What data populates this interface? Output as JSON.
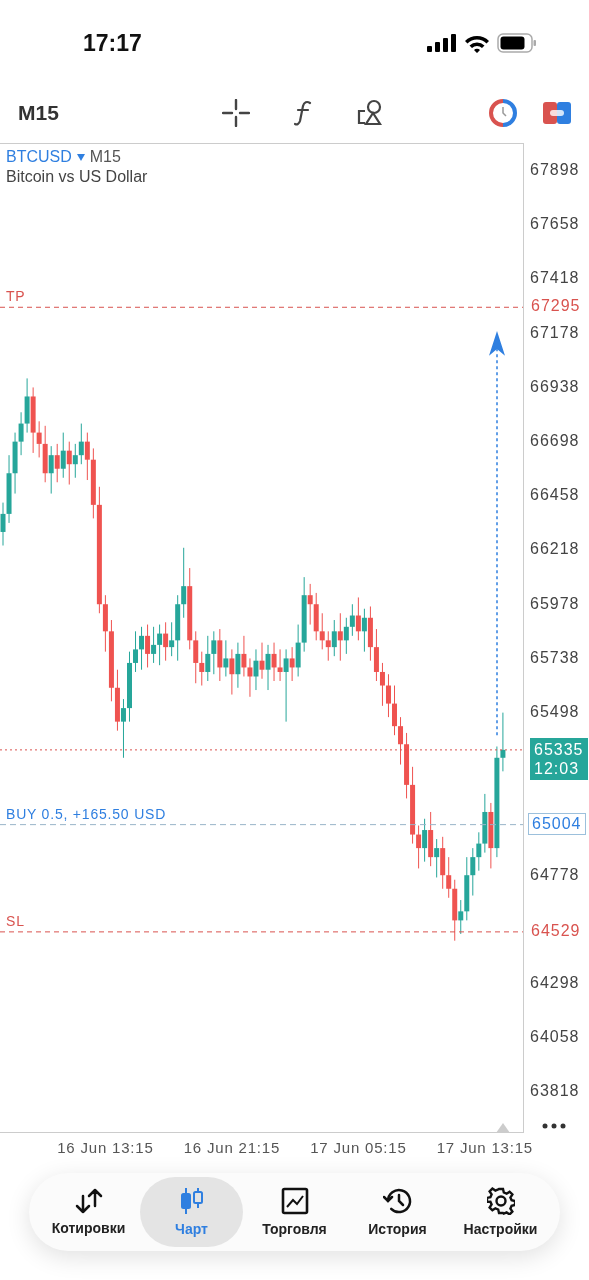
{
  "status_bar": {
    "time": "17:17"
  },
  "toolbar": {
    "timeframe": "M15"
  },
  "chart": {
    "symbol": "BTCUSD",
    "symbol_timeframe": "M15",
    "description": "Bitcoin vs US Dollar",
    "levels": [
      {
        "kind": "tp",
        "label": "TP",
        "price": "67295"
      },
      {
        "kind": "current",
        "price": "65335",
        "timer": "12:03"
      },
      {
        "kind": "buy",
        "label": "BUY 0.5, +165.50 USD",
        "price": "65004"
      },
      {
        "kind": "sl",
        "label": "SL",
        "price": "64529"
      }
    ],
    "chart_data": {
      "type": "candlestick",
      "categories": [
        null,
        null,
        null,
        null,
        null,
        null,
        null,
        null,
        null,
        null,
        null,
        null,
        null,
        null,
        null,
        null,
        null,
        "16 Jun 13:15",
        null,
        null,
        null,
        null,
        null,
        null,
        null,
        null,
        null,
        null,
        null,
        null,
        null,
        null,
        null,
        null,
        null,
        null,
        null,
        null,
        "16 Jun 21:15",
        null,
        null,
        null,
        null,
        null,
        null,
        null,
        null,
        null,
        null,
        null,
        null,
        null,
        null,
        null,
        null,
        null,
        null,
        null,
        null,
        "17 Jun 05:15",
        null,
        null,
        null,
        null,
        null,
        null,
        null,
        null,
        null,
        null,
        null,
        null,
        null,
        null,
        null,
        null,
        null,
        null,
        null,
        null,
        "17 Jun 13:15",
        null,
        null,
        null,
        null,
        null,
        null
      ],
      "ohlc": [
        [
          66300,
          66430,
          66240,
          66380
        ],
        [
          66380,
          66640,
          66340,
          66560
        ],
        [
          66560,
          66740,
          66470,
          66700
        ],
        [
          66700,
          66830,
          66640,
          66780
        ],
        [
          66780,
          66980,
          66740,
          66900
        ],
        [
          66900,
          66940,
          66650,
          66740
        ],
        [
          66740,
          66790,
          66630,
          66690
        ],
        [
          66690,
          66770,
          66520,
          66560
        ],
        [
          66560,
          66680,
          66470,
          66640
        ],
        [
          66640,
          66690,
          66520,
          66580
        ],
        [
          66580,
          66740,
          66540,
          66660
        ],
        [
          66660,
          66700,
          66510,
          66600
        ],
        [
          66600,
          66690,
          66540,
          66640
        ],
        [
          66640,
          66780,
          66600,
          66700
        ],
        [
          66700,
          66740,
          66530,
          66620
        ],
        [
          66620,
          66670,
          66360,
          66420
        ],
        [
          66420,
          66500,
          65940,
          65980
        ],
        [
          65980,
          66020,
          65770,
          65860
        ],
        [
          65860,
          65910,
          65550,
          65610
        ],
        [
          65610,
          65690,
          65420,
          65460
        ],
        [
          65460,
          65560,
          65300,
          65520
        ],
        [
          65520,
          65770,
          65460,
          65720
        ],
        [
          65720,
          65860,
          65680,
          65780
        ],
        [
          65780,
          65880,
          65690,
          65840
        ],
        [
          65840,
          65890,
          65700,
          65760
        ],
        [
          65760,
          65880,
          65720,
          65800
        ],
        [
          65800,
          65890,
          65710,
          65850
        ],
        [
          65850,
          65900,
          65730,
          65790
        ],
        [
          65790,
          65900,
          65750,
          65820
        ],
        [
          65820,
          66020,
          65730,
          65980
        ],
        [
          65980,
          66230,
          65920,
          66060
        ],
        [
          66060,
          66140,
          65780,
          65820
        ],
        [
          65820,
          65860,
          65630,
          65720
        ],
        [
          65720,
          65770,
          65620,
          65680
        ],
        [
          65680,
          65840,
          65640,
          65760
        ],
        [
          65760,
          65860,
          65670,
          65820
        ],
        [
          65820,
          65870,
          65640,
          65700
        ],
        [
          65700,
          65820,
          65660,
          65740
        ],
        [
          65740,
          65780,
          65580,
          65670
        ],
        [
          65670,
          65810,
          65610,
          65760
        ],
        [
          65760,
          65840,
          65660,
          65700
        ],
        [
          65700,
          65740,
          65570,
          65660
        ],
        [
          65660,
          65780,
          65600,
          65730
        ],
        [
          65730,
          65810,
          65650,
          65690
        ],
        [
          65690,
          65800,
          65600,
          65760
        ],
        [
          65760,
          65810,
          65640,
          65700
        ],
        [
          65700,
          65780,
          65640,
          65680
        ],
        [
          65680,
          65780,
          65460,
          65740
        ],
        [
          65740,
          65790,
          65640,
          65700
        ],
        [
          65700,
          65890,
          65660,
          65810
        ],
        [
          65810,
          66100,
          65770,
          66020
        ],
        [
          66020,
          66070,
          65890,
          65980
        ],
        [
          65980,
          66030,
          65820,
          65860
        ],
        [
          65860,
          65940,
          65780,
          65820
        ],
        [
          65820,
          65860,
          65730,
          65790
        ],
        [
          65790,
          65910,
          65750,
          65860
        ],
        [
          65860,
          65940,
          65730,
          65820
        ],
        [
          65820,
          65920,
          65760,
          65880
        ],
        [
          65880,
          65980,
          65840,
          65930
        ],
        [
          65930,
          66010,
          65820,
          65860
        ],
        [
          65860,
          65960,
          65770,
          65920
        ],
        [
          65920,
          65970,
          65730,
          65790
        ],
        [
          65790,
          65870,
          65640,
          65680
        ],
        [
          65680,
          65720,
          65530,
          65620
        ],
        [
          65620,
          65670,
          65480,
          65540
        ],
        [
          65540,
          65620,
          65400,
          65440
        ],
        [
          65440,
          65480,
          65270,
          65360
        ],
        [
          65360,
          65410,
          65120,
          65180
        ],
        [
          65180,
          65260,
          64920,
          64960
        ],
        [
          64960,
          65000,
          64810,
          64900
        ],
        [
          64900,
          65030,
          64840,
          64980
        ],
        [
          64980,
          65060,
          64820,
          64860
        ],
        [
          64860,
          64940,
          64770,
          64900
        ],
        [
          64900,
          64950,
          64720,
          64780
        ],
        [
          64780,
          64860,
          64680,
          64720
        ],
        [
          64720,
          64760,
          64490,
          64580
        ],
        [
          64580,
          64670,
          64520,
          64620
        ],
        [
          64620,
          64860,
          64580,
          64780
        ],
        [
          64780,
          64900,
          64690,
          64860
        ],
        [
          64860,
          64970,
          64800,
          64920
        ],
        [
          64920,
          65140,
          64880,
          65060
        ],
        [
          65060,
          65100,
          64810,
          64900
        ],
        [
          64900,
          65350,
          64860,
          65300
        ],
        [
          65300,
          65500,
          65240,
          65335
        ],
        null,
        null,
        null
      ],
      "yticks": [
        67898,
        67658,
        67418,
        67178,
        66938,
        66698,
        66458,
        66218,
        65978,
        65738,
        65498,
        64778,
        64298,
        64058,
        63818
      ],
      "ylim": [
        63634,
        68018
      ],
      "ref_lines": [
        {
          "axis": "y",
          "value": 67295
        },
        {
          "axis": "y",
          "value": 65335
        },
        {
          "axis": "y",
          "value": 65004
        },
        {
          "axis": "y",
          "value": 64529
        }
      ]
    }
  },
  "nav": [
    {
      "label": "Котировки",
      "selected": false
    },
    {
      "label": "Чарт",
      "selected": true
    },
    {
      "label": "Торговля",
      "selected": false
    },
    {
      "label": "История",
      "selected": false
    },
    {
      "label": "Настройки",
      "selected": false
    }
  ]
}
